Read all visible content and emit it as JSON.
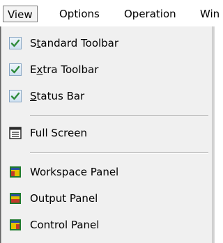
{
  "menubar": {
    "items": [
      {
        "label": "View"
      },
      {
        "label": "Options"
      },
      {
        "label": "Operation"
      },
      {
        "label": "Win"
      }
    ]
  },
  "dropdown": {
    "toggles": [
      {
        "pre": "S",
        "u": "t",
        "post": "andard Toolbar",
        "checked": true
      },
      {
        "pre": "E",
        "u": "x",
        "post": "tra Toolbar",
        "checked": true
      },
      {
        "pre": "",
        "u": "S",
        "post": "tatus Bar",
        "checked": true
      }
    ],
    "full_screen": {
      "label": "Full Screen",
      "icon": "window-icon"
    },
    "panels": [
      {
        "label": "Workspace Panel",
        "icon": "panel-icon"
      },
      {
        "label": "Output Panel",
        "icon": "panel-icon"
      },
      {
        "label": "Control Panel",
        "icon": "panel-icon"
      }
    ]
  },
  "colors": {
    "menu_bg": "#f0f0f0",
    "check": "#2e8b3a",
    "panel_icon_fill": "#e3c100",
    "panel_icon_frame": "#1f7a2e"
  }
}
